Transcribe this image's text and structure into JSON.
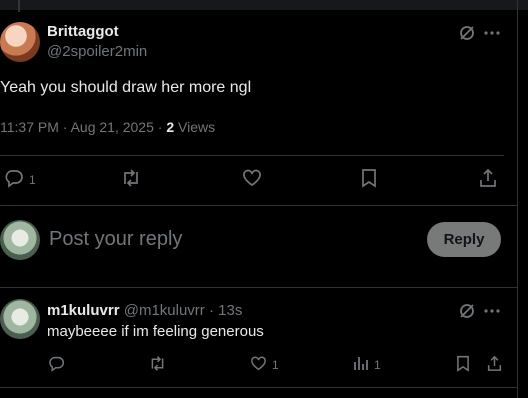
{
  "post": {
    "author_name": "Brittaggot",
    "author_handle": "@2spoiler2min",
    "text": "Yeah you should draw her more ngl",
    "time": "11:37 PM",
    "sep1": "·",
    "date": "Aug 21, 2025",
    "sep2": "·",
    "views_count": "2",
    "views_label": "Views",
    "reply_count": "1",
    "icons": [
      "grok-icon",
      "more-icon",
      "reply-icon",
      "retweet-icon",
      "like-icon",
      "bookmark-icon",
      "share-icon"
    ]
  },
  "composer": {
    "placeholder": "Post your reply",
    "reply_button": "Reply"
  },
  "reply": {
    "author_name": "m1kuluvrr",
    "author_handle": "@m1kuluvrr",
    "sep": "·",
    "time": "13s",
    "text": "maybeeee if im feeling generous",
    "like_count": "1",
    "views_count": "1",
    "icons": [
      "grok-icon",
      "more-icon",
      "reply-icon",
      "retweet-icon",
      "like-icon",
      "views-icon",
      "bookmark-icon",
      "share-icon"
    ]
  },
  "colors": {
    "background": "#000000",
    "text": "#e7e9ea",
    "muted": "#71767b",
    "divider": "#2f3336",
    "reply_button_bg": "#787a7a"
  }
}
